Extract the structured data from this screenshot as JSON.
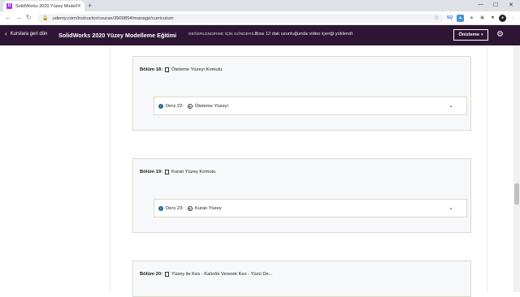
{
  "browser": {
    "tab_title": "SolidWorks 2020 Yüzey Modelle",
    "url": "udemy.com/instructor/course/3900854/manage/curriculum",
    "colors": {
      "tabbar": "#dee1e6",
      "favicon": "#a435f0"
    }
  },
  "header": {
    "back_label": "Kurslara geri dön",
    "course_title": "SolidWorks 2020 Yüzey Modelleme Eğitimi",
    "status": "DEĞERLENDİRME İÇİN GÖNDERİLDİ",
    "info": "5 sa 12 dak uzunluğunda video içeriği yüklendi",
    "preview_label": "Önizleme",
    "colors": {
      "background": "#2d1533"
    }
  },
  "sections": [
    {
      "label": "Bölüm 18:",
      "title": "Öteleme Yüzeyi Komutu",
      "lecture": {
        "label": "Ders 22:",
        "title": "Öteleme Yüzeyi"
      }
    },
    {
      "label": "Bölüm 19:",
      "title": "Kuralı Yüzey Komutu",
      "lecture": {
        "label": "Ders 23:",
        "title": "Kuralı Yüzey"
      }
    },
    {
      "label": "Bölüm 20:",
      "title": "Yüzey ile Kes - Kalınlık Vererek Kes - Yüzü De..."
    }
  ]
}
